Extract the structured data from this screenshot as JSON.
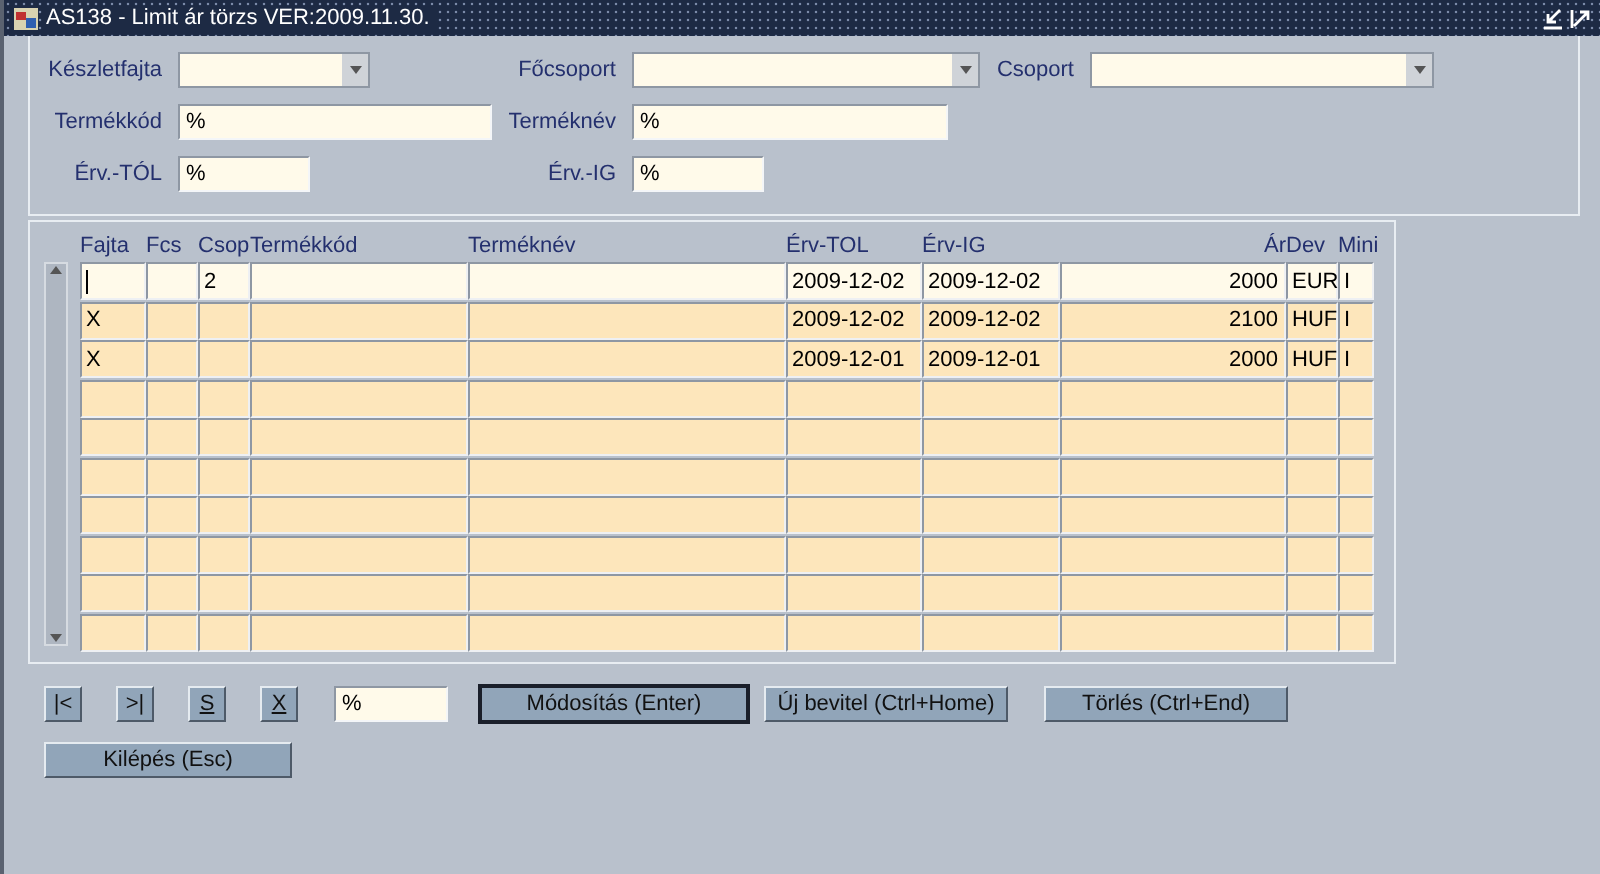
{
  "window": {
    "title": "AS138 - Limit ár törzs VER:2009.11.30."
  },
  "filters": [
    [
      {
        "label": "Készletfajta",
        "kind": "dropdown"
      },
      {
        "label": "Főcsoport",
        "kind": "dropdown"
      },
      {
        "label": "Csoport",
        "kind": "dropdown"
      }
    ],
    [
      {
        "label": "Termékkód",
        "kind": "text",
        "value": "%"
      },
      {
        "label": "Terméknév",
        "kind": "text",
        "value": "%"
      }
    ],
    [
      {
        "label": "Érv.-TÓL",
        "kind": "text",
        "value": "%"
      },
      {
        "label": "Érv.-IG",
        "kind": "text",
        "value": "%"
      }
    ]
  ],
  "table": {
    "columns": [
      "Fajta",
      "Fcs",
      "Csop",
      "Termékkód",
      "Terméknév",
      "Érv-TOL",
      "Érv-IG",
      "Ár",
      "Dev",
      "Mini"
    ],
    "rows": [
      {
        "selected": true,
        "cells": [
          null,
          null,
          "2",
          null,
          null,
          "2009-12-02",
          "2009-12-02",
          "2000",
          "EUR",
          "I"
        ]
      },
      {
        "selected": false,
        "cells": [
          "X",
          null,
          null,
          null,
          null,
          "2009-12-02",
          "2009-12-02",
          "2100",
          "HUF",
          "I"
        ]
      },
      {
        "selected": false,
        "cells": [
          "X",
          null,
          null,
          null,
          null,
          "2009-12-01",
          "2009-12-01",
          "2000",
          "HUF",
          "I"
        ]
      },
      {
        "selected": false
      },
      {
        "selected": false
      },
      {
        "selected": false
      },
      {
        "selected": false
      },
      {
        "selected": false
      },
      {
        "selected": false
      },
      {
        "selected": false
      }
    ]
  },
  "nav_buttons": [
    {
      "label": "|<",
      "underlined": false
    },
    {
      "label": ">|",
      "underlined": false
    },
    {
      "label": "S",
      "underlined": true
    },
    {
      "label": "X",
      "underlined": true
    }
  ],
  "search": {
    "value": "%"
  },
  "actions": [
    {
      "label": "Módosítás (Enter)",
      "focused": true
    },
    {
      "label": "Új bevitel (Ctrl+Home)",
      "focused": false
    },
    {
      "label": "Törlés (Ctrl+End)",
      "focused": false
    }
  ],
  "exit_button": {
    "label": "Kilépés (Esc)"
  }
}
